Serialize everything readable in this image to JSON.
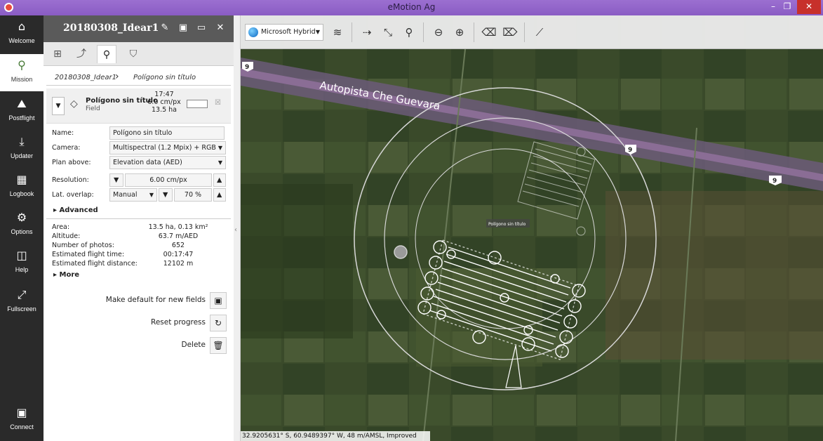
{
  "window": {
    "title": "eMotion Ag",
    "min": "–",
    "max": "❐",
    "close": "✕"
  },
  "nav": {
    "items": [
      {
        "label": "Welcome",
        "icon": "home-icon",
        "glyph": "⌂"
      },
      {
        "label": "Mission",
        "icon": "waypoints-icon",
        "glyph": "⚲"
      },
      {
        "label": "Postflight",
        "icon": "postflight-icon",
        "glyph": "⛰"
      },
      {
        "label": "Updater",
        "icon": "download-icon",
        "glyph": "⤓"
      },
      {
        "label": "Logbook",
        "icon": "calendar-icon",
        "glyph": "▦"
      },
      {
        "label": "Options",
        "icon": "gear-icon",
        "glyph": "⚙"
      },
      {
        "label": "Help",
        "icon": "book-icon",
        "glyph": "◫"
      },
      {
        "label": "Fullscreen",
        "icon": "fullscreen-icon",
        "glyph": "⤢"
      },
      {
        "label": "Connect",
        "icon": "connect-icon",
        "glyph": "▣"
      }
    ]
  },
  "panel": {
    "project_name": "20180308_Idear1",
    "breadcrumb": {
      "root": "20180308_Idear1",
      "current": "Polígono sin título"
    },
    "field": {
      "title": "Polígono sin título",
      "type": "Field",
      "time": "17:47",
      "gsd": "6.0 cm/px",
      "area": "13.5 ha"
    },
    "form": {
      "name_label": "Name:",
      "name_value": "Polígono sin título",
      "camera_label": "Camera:",
      "camera_value": "Multispectral (1.2 Mpix) + RGB",
      "plan_label": "Plan above:",
      "plan_value": "Elevation data (AED)",
      "resolution_label": "Resolution:",
      "resolution_value": "6.00 cm/px",
      "overlap_label": "Lat. overlap:",
      "overlap_mode": "Manual",
      "overlap_value": "70 %"
    },
    "advanced_label": "Advanced",
    "stats": [
      {
        "k": "Area:",
        "v": "13.5 ha, 0.13 km²"
      },
      {
        "k": "Altitude:",
        "v": "63.7 m/AED"
      },
      {
        "k": "Number of photos:",
        "v": "652"
      },
      {
        "k": "Estimated flight time:",
        "v": "00:17:47"
      },
      {
        "k": "Estimated flight distance:",
        "v": "12102 m"
      }
    ],
    "more_label": "More",
    "actions": {
      "make_default": "Make default for new fields",
      "reset_progress": "Reset progress",
      "delete": "Delete"
    }
  },
  "toolbar": {
    "basemap": "Microsoft Hybrid"
  },
  "map": {
    "road_label": "Autopista Che Guevara",
    "route_shield": "9",
    "polygon_label": "Polígono sin título"
  },
  "status": {
    "coords": "32.9205631° S, 60.9489397° W, 48 m/AMSL, Improved SRTM"
  }
}
